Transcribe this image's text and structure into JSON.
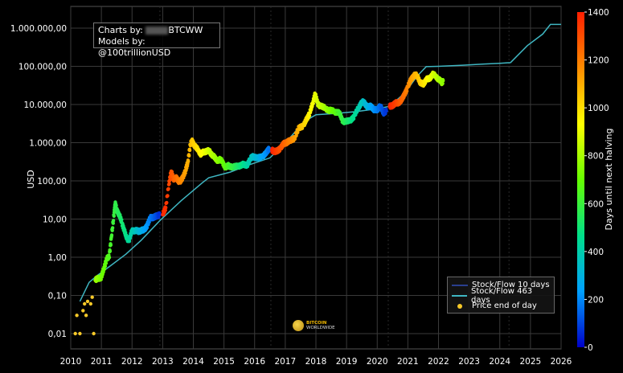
{
  "credits": {
    "line1_prefix": "Charts by: ",
    "line1_suffix": "BTCWW",
    "line2": "Models by: @100trillionUSD"
  },
  "legend": {
    "items": [
      {
        "label": "Stock/Flow 10 days",
        "color": "#2a3f8f",
        "kind": "line"
      },
      {
        "label": "Stock/Flow 463 days",
        "color": "#3fb6c2",
        "kind": "line"
      },
      {
        "label": "Price end of day",
        "color": "#f7c928",
        "kind": "dot"
      }
    ]
  },
  "watermark": {
    "line1": "BITCOIN",
    "line2": "WORLDWIDE"
  },
  "chart_data": {
    "type": "scatter",
    "title": "",
    "ylabel": "USD",
    "xlabel": "",
    "yscale": "log",
    "ylim": [
      0.01,
      1500000
    ],
    "xlim": [
      2010.0,
      2026.0
    ],
    "y_ticks": [
      {
        "value": 0.01,
        "label": "0,01"
      },
      {
        "value": 0.1,
        "label": "0,10"
      },
      {
        "value": 1,
        "label": "1,00"
      },
      {
        "value": 10,
        "label": "10,00"
      },
      {
        "value": 100,
        "label": "100,00"
      },
      {
        "value": 1000,
        "label": "1.000,00"
      },
      {
        "value": 10000,
        "label": "10.000,00"
      },
      {
        "value": 100000,
        "label": "100.000,00"
      },
      {
        "value": 1000000,
        "label": "1.000.000,00"
      }
    ],
    "x_ticks": [
      "2010",
      "2011",
      "2012",
      "2013",
      "2014",
      "2015",
      "2016",
      "2017",
      "2018",
      "2019",
      "2020",
      "2021",
      "2022",
      "2023",
      "2024",
      "2025",
      "2026"
    ],
    "colorbar": {
      "label": "Days until next halving",
      "min": 0,
      "max": 1400,
      "ticks": [
        0,
        200,
        400,
        600,
        800,
        1000,
        1200,
        1400
      ],
      "colormap": [
        "#0000c8",
        "#00a0ff",
        "#00e08a",
        "#66ff00",
        "#ffff00",
        "#ff8c00",
        "#ff1e00"
      ]
    },
    "halvings": [
      2012.91,
      2016.53,
      2020.36,
      2024.3
    ],
    "series": [
      {
        "name": "Stock/Flow 463 days",
        "points": [
          [
            2010.3,
            0.07
          ],
          [
            2010.6,
            0.22
          ],
          [
            2010.9,
            0.35
          ],
          [
            2011.3,
            0.6
          ],
          [
            2011.8,
            1.2
          ],
          [
            2012.3,
            2.8
          ],
          [
            2012.9,
            9
          ],
          [
            2013.6,
            30
          ],
          [
            2014.3,
            90
          ],
          [
            2014.5,
            120
          ],
          [
            2015.2,
            170
          ],
          [
            2015.8,
            260
          ],
          [
            2016.5,
            400
          ],
          [
            2017.1,
            1200
          ],
          [
            2017.6,
            3500
          ],
          [
            2018.0,
            5400
          ],
          [
            2018.6,
            5800
          ],
          [
            2019.3,
            6500
          ],
          [
            2020.0,
            7700
          ],
          [
            2020.4,
            9000
          ],
          [
            2020.9,
            20000
          ],
          [
            2021.3,
            55000
          ],
          [
            2021.6,
            98000
          ],
          [
            2022.0,
            100000
          ],
          [
            2022.8,
            107000
          ],
          [
            2023.5,
            115000
          ],
          [
            2024.0,
            120000
          ],
          [
            2024.35,
            125000
          ],
          [
            2024.9,
            350000
          ],
          [
            2025.4,
            700000
          ],
          [
            2025.65,
            1250000
          ],
          [
            2026.0,
            1250000
          ]
        ]
      },
      {
        "name": "Price end of day",
        "points": [
          [
            2010.15,
            0.01,
            1020
          ],
          [
            2010.3,
            0.01,
            1000
          ],
          [
            2010.75,
            0.01,
            800
          ],
          [
            2010.2,
            0.03,
            1010
          ],
          [
            2010.5,
            0.03,
            900
          ],
          [
            2010.4,
            0.04,
            950
          ],
          [
            2010.45,
            0.06,
            920
          ],
          [
            2010.55,
            0.07,
            880
          ],
          [
            2010.65,
            0.06,
            840
          ],
          [
            2010.7,
            0.09,
            820
          ],
          [
            2010.8,
            0.25,
            790
          ],
          [
            2010.9,
            0.28,
            760
          ],
          [
            2011.0,
            0.3,
            720
          ],
          [
            2011.08,
            0.5,
            700
          ],
          [
            2011.17,
            0.9,
            670
          ],
          [
            2011.25,
            1.0,
            650
          ],
          [
            2011.33,
            3.5,
            620
          ],
          [
            2011.42,
            15,
            590
          ],
          [
            2011.45,
            25,
            580
          ],
          [
            2011.5,
            18,
            570
          ],
          [
            2011.58,
            13,
            545
          ],
          [
            2011.67,
            8,
            515
          ],
          [
            2011.75,
            5,
            490
          ],
          [
            2011.83,
            3,
            460
          ],
          [
            2011.92,
            3,
            430
          ],
          [
            2012.0,
            5,
            400
          ],
          [
            2012.1,
            5,
            365
          ],
          [
            2012.2,
            4.8,
            330
          ],
          [
            2012.3,
            5,
            290
          ],
          [
            2012.4,
            5.2,
            255
          ],
          [
            2012.5,
            7,
            220
          ],
          [
            2012.6,
            11,
            180
          ],
          [
            2012.7,
            11,
            145
          ],
          [
            2012.8,
            12,
            110
          ],
          [
            2012.9,
            13,
            60
          ],
          [
            2013.0,
            13,
            1380
          ],
          [
            2013.1,
            20,
            1360
          ],
          [
            2013.2,
            80,
            1320
          ],
          [
            2013.28,
            180,
            1290
          ],
          [
            2013.35,
            110,
            1265
          ],
          [
            2013.45,
            120,
            1230
          ],
          [
            2013.55,
            90,
            1190
          ],
          [
            2013.65,
            120,
            1160
          ],
          [
            2013.75,
            190,
            1120
          ],
          [
            2013.82,
            300,
            1100
          ],
          [
            2013.9,
            900,
            1070
          ],
          [
            2013.97,
            1100,
            1045
          ],
          [
            2014.05,
            800,
            1020
          ],
          [
            2014.15,
            650,
            985
          ],
          [
            2014.25,
            500,
            950
          ],
          [
            2014.35,
            580,
            915
          ],
          [
            2014.45,
            620,
            880
          ],
          [
            2014.55,
            560,
            845
          ],
          [
            2014.65,
            450,
            810
          ],
          [
            2014.75,
            350,
            775
          ],
          [
            2014.85,
            360,
            740
          ],
          [
            2014.95,
            320,
            705
          ],
          [
            2015.05,
            220,
            670
          ],
          [
            2015.15,
            250,
            630
          ],
          [
            2015.3,
            230,
            580
          ],
          [
            2015.45,
            240,
            525
          ],
          [
            2015.6,
            270,
            470
          ],
          [
            2015.75,
            250,
            420
          ],
          [
            2015.85,
            380,
            380
          ],
          [
            2015.95,
            430,
            345
          ],
          [
            2016.1,
            400,
            300
          ],
          [
            2016.25,
            420,
            250
          ],
          [
            2016.4,
            580,
            200
          ],
          [
            2016.48,
            700,
            160
          ],
          [
            2016.55,
            650,
            1400
          ],
          [
            2016.65,
            580,
            1360
          ],
          [
            2016.75,
            620,
            1320
          ],
          [
            2016.85,
            720,
            1290
          ],
          [
            2016.95,
            960,
            1260
          ],
          [
            2017.05,
            1000,
            1220
          ],
          [
            2017.15,
            1150,
            1190
          ],
          [
            2017.3,
            1300,
            1140
          ],
          [
            2017.45,
            2500,
            1080
          ],
          [
            2017.6,
            2800,
            1030
          ],
          [
            2017.7,
            4200,
            990
          ],
          [
            2017.8,
            6000,
            950
          ],
          [
            2017.9,
            11000,
            920
          ],
          [
            2017.97,
            19000,
            900
          ],
          [
            2018.05,
            11000,
            870
          ],
          [
            2018.15,
            9000,
            840
          ],
          [
            2018.3,
            8000,
            790
          ],
          [
            2018.45,
            7000,
            730
          ],
          [
            2018.6,
            6500,
            680
          ],
          [
            2018.75,
            6400,
            620
          ],
          [
            2018.85,
            4000,
            590
          ],
          [
            2018.95,
            3500,
            550
          ],
          [
            2019.1,
            3700,
            500
          ],
          [
            2019.25,
            5000,
            450
          ],
          [
            2019.4,
            8500,
            400
          ],
          [
            2019.5,
            12000,
            365
          ],
          [
            2019.6,
            10500,
            330
          ],
          [
            2019.7,
            8500,
            290
          ],
          [
            2019.8,
            9000,
            255
          ],
          [
            2019.9,
            7300,
            215
          ],
          [
            2020.0,
            7200,
            185
          ],
          [
            2020.1,
            9500,
            150
          ],
          [
            2020.2,
            6000,
            110
          ],
          [
            2020.3,
            6800,
            70
          ],
          [
            2020.4,
            9000,
            1400
          ],
          [
            2020.5,
            9300,
            1360
          ],
          [
            2020.6,
            11000,
            1330
          ],
          [
            2020.7,
            11000,
            1290
          ],
          [
            2020.8,
            13500,
            1255
          ],
          [
            2020.9,
            19000,
            1220
          ],
          [
            2021.0,
            29000,
            1180
          ],
          [
            2021.1,
            45000,
            1140
          ],
          [
            2021.2,
            57000,
            1100
          ],
          [
            2021.3,
            59000,
            1070
          ],
          [
            2021.4,
            37000,
            1030
          ],
          [
            2021.5,
            34000,
            995
          ],
          [
            2021.6,
            45000,
            955
          ],
          [
            2021.7,
            47000,
            920
          ],
          [
            2021.8,
            61000,
            880
          ],
          [
            2021.9,
            57000,
            845
          ],
          [
            2022.0,
            46000,
            810
          ],
          [
            2022.1,
            38000,
            775
          ],
          [
            2022.15,
            42000,
            755
          ]
        ]
      }
    ]
  }
}
